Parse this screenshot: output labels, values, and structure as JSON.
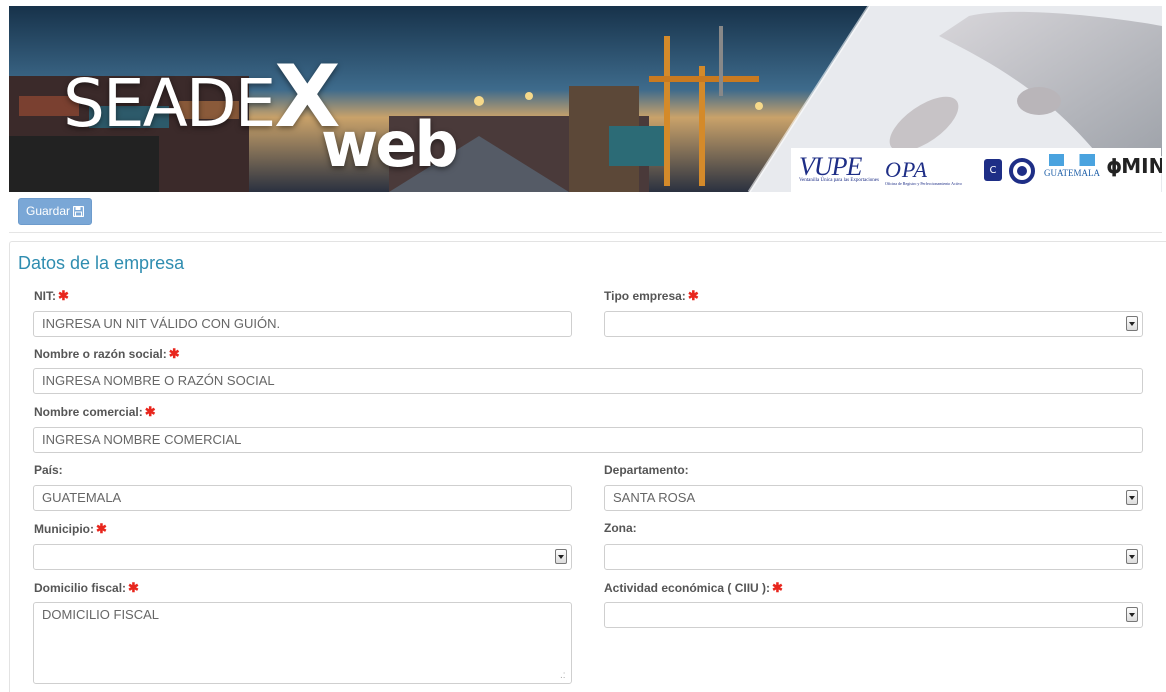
{
  "banner": {
    "logo_main": "SEADE",
    "logo_x": "X",
    "logo_web": "web",
    "partners": {
      "vupe": "VUPE",
      "vupe_sub": "Ventanilla Única para las Exportaciones",
      "opa": "OPA",
      "opa_sub": "Oficina de Registro y Perfeccionamiento Activo",
      "guatemala": "GUATEMALA",
      "min": "MIN"
    }
  },
  "toolbar": {
    "save_label": "Guardar",
    "save_icon": "floppy-disk-icon"
  },
  "form": {
    "section_title": "Datos de la empresa",
    "required_marker": "✱",
    "nit": {
      "label": "NIT:",
      "placeholder": "INGRESA UN NIT VÁLIDO CON GUIÓN."
    },
    "tipo_empresa": {
      "label": "Tipo empresa:",
      "value": ""
    },
    "razon_social": {
      "label": "Nombre o razón social:",
      "placeholder": "INGRESA NOMBRE O RAZÓN SOCIAL"
    },
    "nombre_comercial": {
      "label": "Nombre comercial:",
      "placeholder": "INGRESA NOMBRE COMERCIAL"
    },
    "pais": {
      "label": "País:",
      "value": "GUATEMALA"
    },
    "departamento": {
      "label": "Departamento:",
      "value": "SANTA ROSA"
    },
    "municipio": {
      "label": "Municipio:",
      "value": ""
    },
    "zona": {
      "label": "Zona:",
      "value": ""
    },
    "domicilio_fiscal": {
      "label": "Domicilio fiscal:",
      "placeholder": "DOMICILIO FISCAL"
    },
    "actividad": {
      "label": "Actividad económica ( CIIU ):",
      "value": ""
    }
  },
  "colors": {
    "accent_title": "#2f8db0",
    "button_bg": "#7aa7d6",
    "required": "#e8261d"
  }
}
